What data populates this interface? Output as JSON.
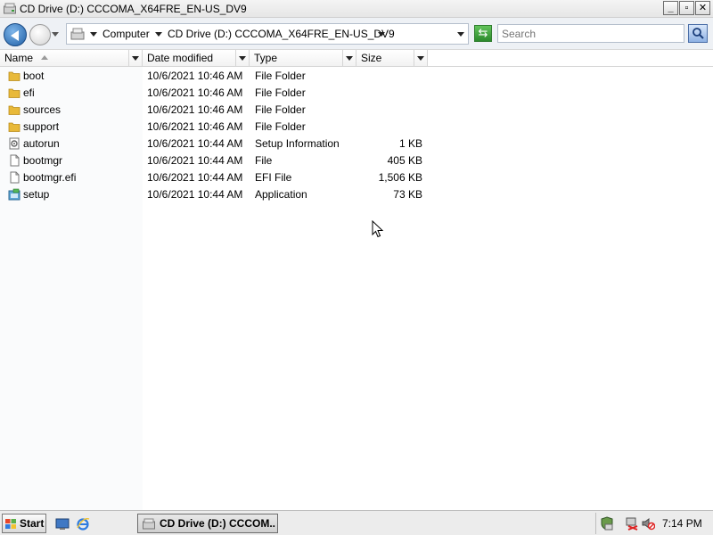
{
  "window": {
    "title": "CD Drive (D:) CCCOMA_X64FRE_EN-US_DV9",
    "controls": [
      "minimize",
      "maximize",
      "close"
    ]
  },
  "navbar": {
    "breadcrumbs": [
      "Computer",
      "CD Drive (D:) CCCOMA_X64FRE_EN-US_DV9"
    ],
    "search_placeholder": "Search"
  },
  "columns": {
    "name": "Name",
    "date": "Date modified",
    "type": "Type",
    "size": "Size"
  },
  "files": [
    {
      "name": "boot",
      "date": "10/6/2021 10:46 AM",
      "type": "File Folder",
      "size": "",
      "icon": "folder-icon"
    },
    {
      "name": "efi",
      "date": "10/6/2021 10:46 AM",
      "type": "File Folder",
      "size": "",
      "icon": "folder-icon"
    },
    {
      "name": "sources",
      "date": "10/6/2021 10:46 AM",
      "type": "File Folder",
      "size": "",
      "icon": "folder-icon"
    },
    {
      "name": "support",
      "date": "10/6/2021 10:46 AM",
      "type": "File Folder",
      "size": "",
      "icon": "folder-icon"
    },
    {
      "name": "autorun",
      "date": "10/6/2021 10:44 AM",
      "type": "Setup Information",
      "size": "1 KB",
      "icon": "setup-info-icon"
    },
    {
      "name": "bootmgr",
      "date": "10/6/2021 10:44 AM",
      "type": "File",
      "size": "405 KB",
      "icon": "file-icon"
    },
    {
      "name": "bootmgr.efi",
      "date": "10/6/2021 10:44 AM",
      "type": "EFI File",
      "size": "1,506 KB",
      "icon": "file-icon"
    },
    {
      "name": "setup",
      "date": "10/6/2021 10:44 AM",
      "type": "Application",
      "size": "73 KB",
      "icon": "application-icon"
    }
  ],
  "taskbar": {
    "start_label": "Start",
    "task_label": "CD Drive (D:) CCCOM...",
    "clock": "7:14 PM"
  },
  "colors": {
    "folder": "#e8b93a",
    "accent": "#1f5fa6"
  }
}
